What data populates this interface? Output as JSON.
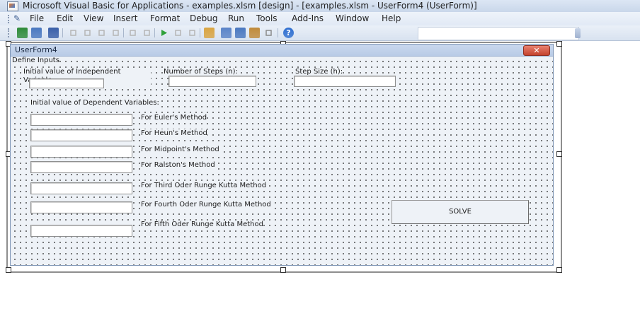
{
  "window": {
    "title": "Microsoft Visual Basic for Applications - examples.xlsm [design] - [examples.xlsm - UserForm4 (UserForm)]"
  },
  "menu": {
    "items": [
      "File",
      "Edit",
      "View",
      "Insert",
      "Format",
      "Debug",
      "Run",
      "Tools",
      "Add-Ins",
      "Window",
      "Help"
    ]
  },
  "toolbar": {
    "buttons": [
      {
        "name": "view-excel-icon",
        "color": "#2e8b3a"
      },
      {
        "name": "insert-userform-icon",
        "color": "#4a78c0"
      },
      {
        "name": "save-icon",
        "color": "#3a5fa8"
      },
      {
        "name": "cut-icon",
        "color": "#b5b5b5"
      },
      {
        "name": "copy-icon",
        "color": "#b5b5b5"
      },
      {
        "name": "paste-icon",
        "color": "#b5b5b5"
      },
      {
        "name": "find-icon",
        "color": "#b5b5b5"
      },
      {
        "name": "undo-icon",
        "color": "#b5b5b5"
      },
      {
        "name": "redo-icon",
        "color": "#b5b5b5"
      },
      {
        "name": "run-icon",
        "color": "#2fa13a"
      },
      {
        "name": "break-icon",
        "color": "#b5b5b5"
      },
      {
        "name": "reset-icon",
        "color": "#b5b5b5"
      },
      {
        "name": "design-mode-icon",
        "color": "#d9a441"
      },
      {
        "name": "project-explorer-icon",
        "color": "#5a84c8"
      },
      {
        "name": "properties-window-icon",
        "color": "#4a78c0"
      },
      {
        "name": "object-browser-icon",
        "color": "#c08a3a"
      },
      {
        "name": "toolbox-icon",
        "color": "#8a8a8a"
      },
      {
        "name": "help-icon",
        "color": "#2f6fd0"
      }
    ]
  },
  "userform": {
    "title": "UserForm4",
    "close_label": "✕",
    "define_inputs": "Define Inputs",
    "initial_independent": "Initial value of Independent Variable:",
    "steps_label": "Number of Steps (n):",
    "step_size_label": "Step Size (h):",
    "dependent_label": "Initial value of Dependent Variables:",
    "methods": [
      "For Euler's Method",
      "For Heun's Method",
      "For Midpoint's Method",
      "For Ralston's Method",
      "For Third Oder Runge Kutta Method",
      "For Fourth Oder Runge Kutta Method",
      "For Fifth Oder Runge Kutta Method"
    ],
    "solve_label": "SOLVE",
    "inputs": {
      "independent": "",
      "steps": "",
      "step_size": "",
      "dependent": [
        "",
        "",
        "",
        "",
        "",
        "",
        ""
      ]
    }
  }
}
